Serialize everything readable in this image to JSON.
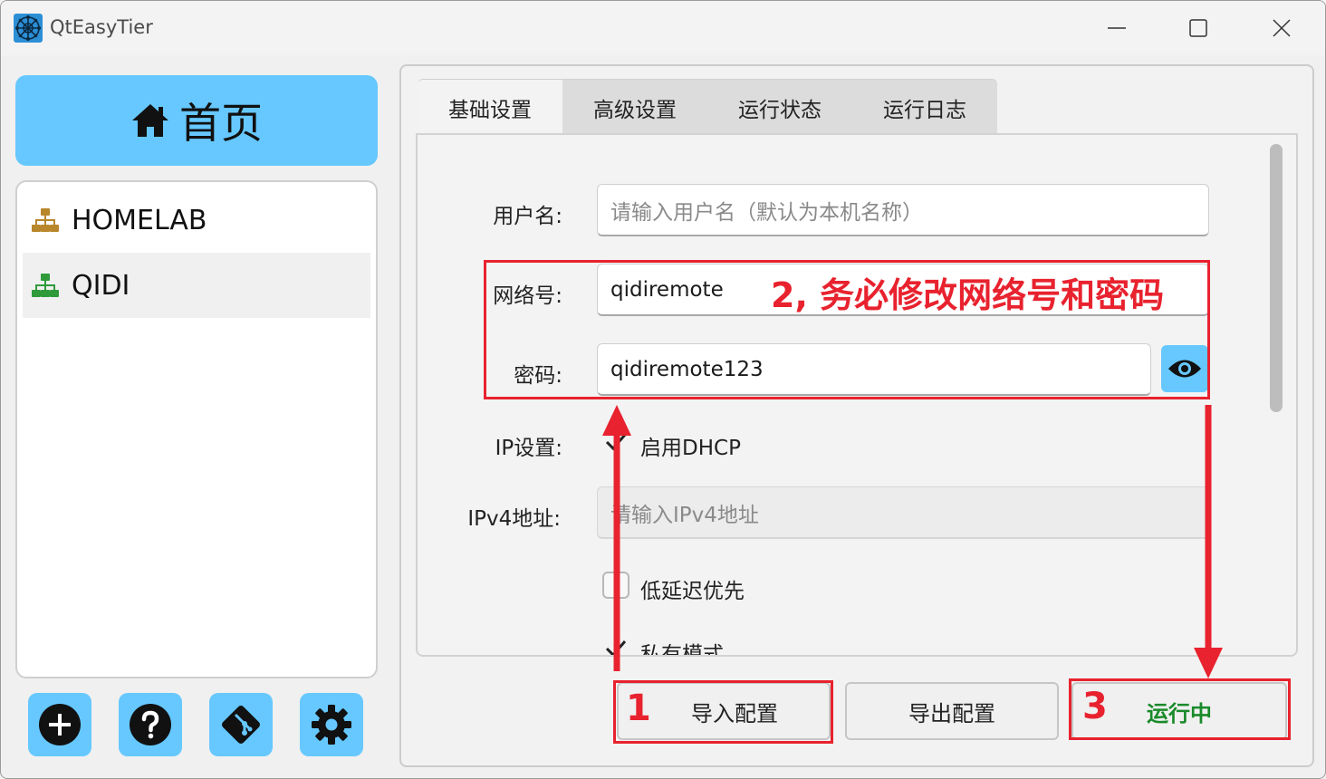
{
  "window": {
    "title": "QtEasyTier"
  },
  "sidebar": {
    "home_label": "首页",
    "networks": [
      {
        "label": "HOMELAB",
        "color": "#b8862b"
      },
      {
        "label": "QIDI",
        "color": "#2e9a3a",
        "selected": true
      }
    ],
    "tools": [
      "plus-icon",
      "help-icon",
      "git-icon",
      "gear-icon"
    ]
  },
  "tabs": [
    {
      "label": "基础设置",
      "active": true
    },
    {
      "label": "高级设置"
    },
    {
      "label": "运行状态"
    },
    {
      "label": "运行日志"
    }
  ],
  "form": {
    "username_label": "用户名:",
    "username_placeholder": "请输入用户名（默认为本机名称）",
    "network_label": "网络号:",
    "network_value": "qidiremote",
    "password_label": "密码:",
    "password_value": "qidiremote123",
    "ip_label": "IP设置:",
    "dhcp_label": "启用DHCP",
    "dhcp_checked": true,
    "ipv4_label": "IPv4地址:",
    "ipv4_placeholder": "请输入IPv4地址",
    "low_latency_label": "低延迟优先",
    "low_latency_checked": false,
    "private_mode_label": "私有模式",
    "private_mode_checked": true
  },
  "actions": {
    "import_label": "导入配置",
    "export_label": "导出配置",
    "run_label": "运行中"
  },
  "annotations": {
    "step1": "1",
    "step2": "2, 务必修改网络号和密码",
    "step3": "3",
    "color": "#e8222e"
  },
  "colors": {
    "accent": "#66c8ff",
    "running": "#1a8a2a"
  }
}
